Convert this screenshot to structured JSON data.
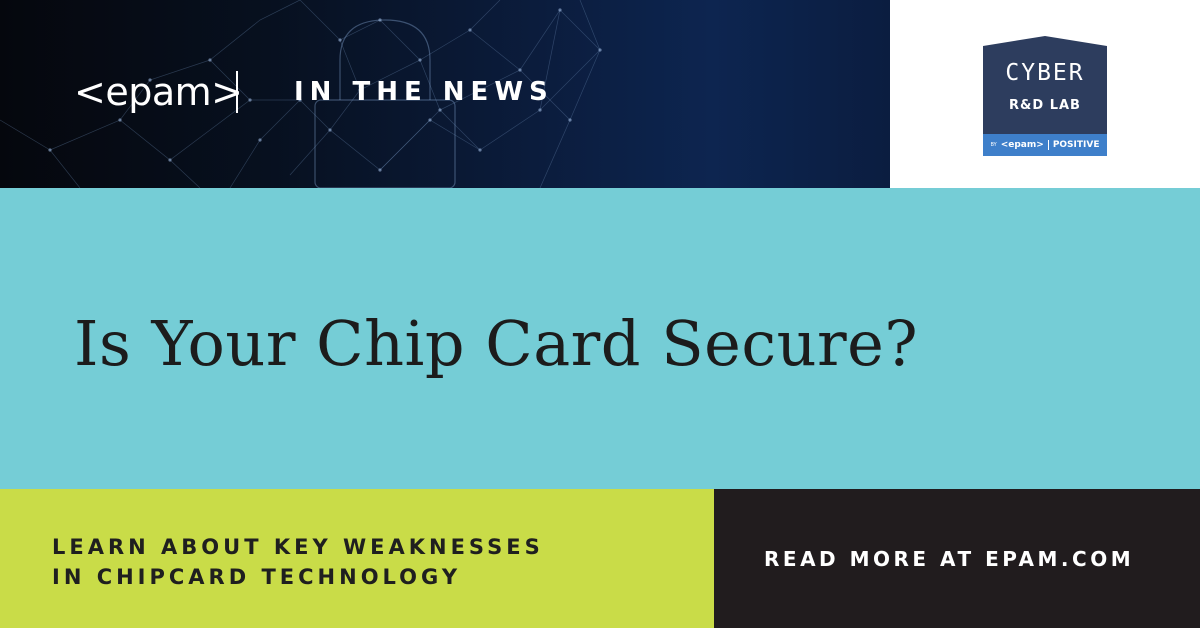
{
  "header": {
    "logo_text": "<epam>",
    "section_label": "IN THE NEWS"
  },
  "badge": {
    "line1": "CYBER",
    "line2": "R&D LAB",
    "footer_by": "BY",
    "footer_left": "<epam>",
    "footer_right": "POSITIVE",
    "colors": {
      "top": "#2d3d5e",
      "footer": "#3e7fca"
    }
  },
  "headline": {
    "text": "Is Your Chip Card Secure?"
  },
  "footer": {
    "learn_line1": "LEARN ABOUT KEY WEAKNESSES",
    "learn_line2": "IN CHIPCARD TECHNOLOGY",
    "cta": "READ MORE AT EPAM.COM"
  },
  "colors": {
    "teal_band": "#75cdd6",
    "lime_band": "#c9dc48",
    "dark_band": "#211c1e",
    "banner_dark": "#0b1c3c"
  },
  "icons": [
    "network-padlock-graphic",
    "cyber-lab-badge"
  ]
}
